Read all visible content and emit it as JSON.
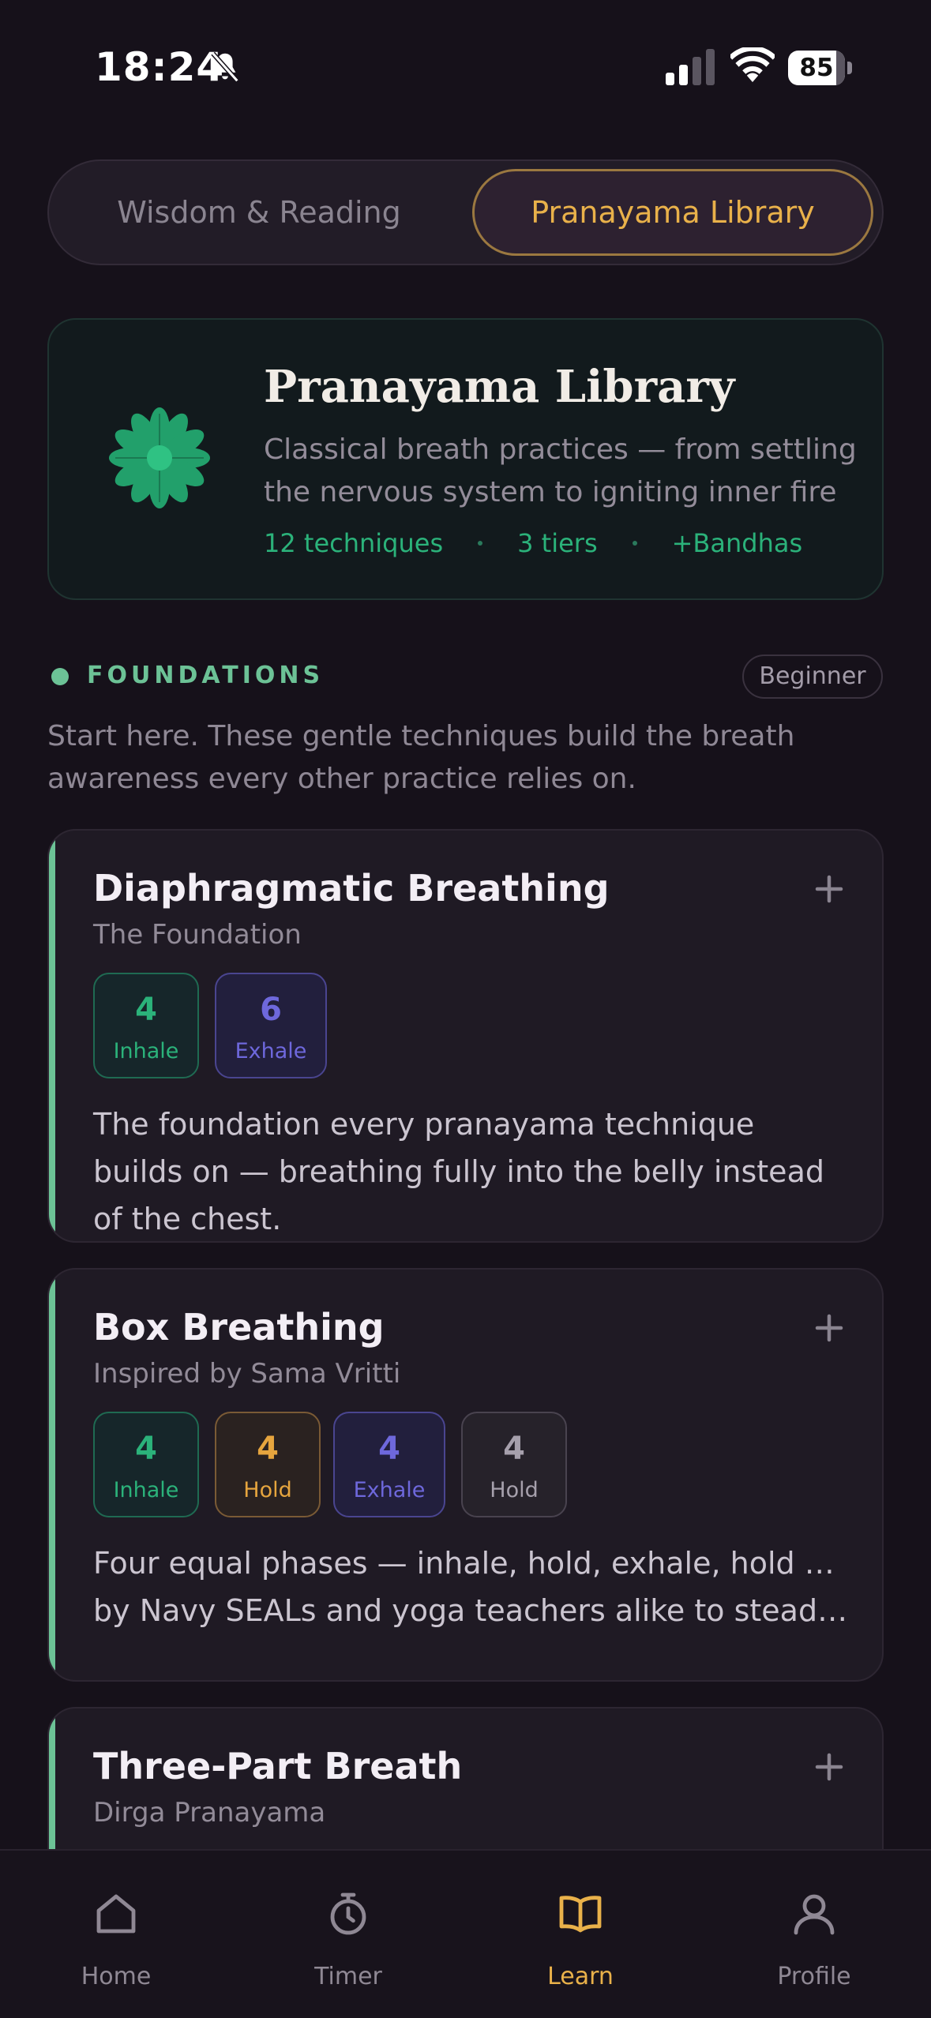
{
  "status_bar": {
    "time": "18:24",
    "battery": "85",
    "battery_level": 0.85,
    "icons": [
      "bell-slash-icon",
      "signal-icon",
      "wifi-icon",
      "battery-icon"
    ]
  },
  "segmented": {
    "tabs": [
      {
        "label": "Wisdom & Reading",
        "active": false
      },
      {
        "label": "Pranayama Library",
        "active": true
      }
    ]
  },
  "hero": {
    "icon": "lotus-icon",
    "title": "Pranayama Library",
    "description": "Classical breath practices — from settling the nervous system to igniting inner fire",
    "stats": [
      "12 techniques",
      "3 tiers",
      "+Bandhas"
    ]
  },
  "section": {
    "title": "FOUNDATIONS",
    "level": "Beginner",
    "description": "Start here. These gentle techniques build the breath awareness every other practice relies on."
  },
  "techniques": [
    {
      "title": "Diaphragmatic Breathing",
      "subtitle": "The Foundation",
      "phases": [
        {
          "value": "4",
          "label": "Inhale",
          "kind": "inhale"
        },
        {
          "value": "6",
          "label": "Exhale",
          "kind": "exhale"
        }
      ],
      "description": "The foundation every pranayama technique builds on — breathing fully into the belly instead of the chest."
    },
    {
      "title": "Box Breathing",
      "subtitle": "Inspired by Sama Vritti",
      "phases": [
        {
          "value": "4",
          "label": "Inhale",
          "kind": "inhale"
        },
        {
          "value": "4",
          "label": "Hold",
          "kind": "hold"
        },
        {
          "value": "4",
          "label": "Exhale",
          "kind": "exhale"
        },
        {
          "value": "4",
          "label": "Hold",
          "kind": "hold2"
        }
      ],
      "description_lines": [
        "Four equal phases — inhale, hold, exhale, hold — used",
        "by Navy SEALs and yoga teachers alike to steady the…"
      ]
    },
    {
      "title": "Three-Part Breath",
      "subtitle": "Dirga Pranayama"
    }
  ],
  "tab_bar": {
    "items": [
      {
        "label": "Home",
        "icon": "home-icon",
        "active": false
      },
      {
        "label": "Timer",
        "icon": "timer-icon",
        "active": false
      },
      {
        "label": "Learn",
        "icon": "book-icon",
        "active": true
      },
      {
        "label": "Profile",
        "icon": "profile-icon",
        "active": false
      }
    ]
  },
  "colors": {
    "background": "#16111a",
    "accent_gold": "#e9b14a",
    "accent_green": "#2bb27a",
    "section_green": "#6cc296",
    "exhale_purple": "#6e68dc"
  }
}
